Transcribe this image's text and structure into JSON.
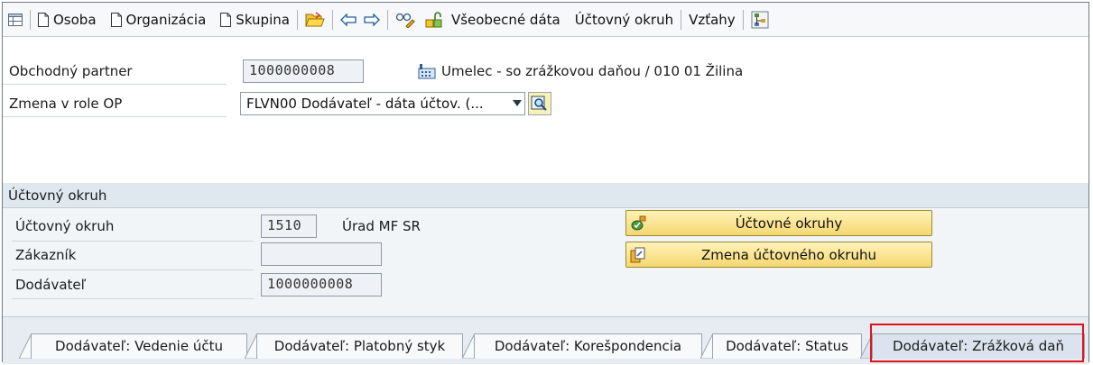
{
  "toolbar": {
    "person": "Osoba",
    "organization": "Organizácia",
    "group": "Skupina",
    "general_data": "Všeobecné dáta",
    "company_code": "Účtovný okruh",
    "relationships": "Vzťahy"
  },
  "header": {
    "partner_label": "Obchodný partner",
    "partner_value": "1000000008",
    "partner_description": "Umelec - so zrážkovou daňou / 010 01 Žilina",
    "role_label": "Zmena v role OP",
    "role_value": "FLVN00 Dodávateľ - dáta účtov. (..."
  },
  "company_code_group": {
    "title": "Účtovný okruh",
    "code_label": "Účtovný okruh",
    "code_value": "1510",
    "code_description": "Úrad MF SR",
    "customer_label": "Zákazník",
    "customer_value": "",
    "vendor_label": "Dodávateľ",
    "vendor_value": "1000000008",
    "btn_company_codes": "Účtovné okruhy",
    "btn_change_company_code": "Zmena účtovného okruhu"
  },
  "tabs": [
    {
      "label": "Dodávateľ: Vedenie účtu"
    },
    {
      "label": "Dodávateľ: Platobný styk"
    },
    {
      "label": "Dodávateľ: Korešpondencia"
    },
    {
      "label": "Dodávateľ: Status"
    },
    {
      "label": "Dodávateľ: Zrážková daň"
    }
  ],
  "colors": {
    "highlight": "#e0121a",
    "button_yellow": "#f5d870"
  }
}
